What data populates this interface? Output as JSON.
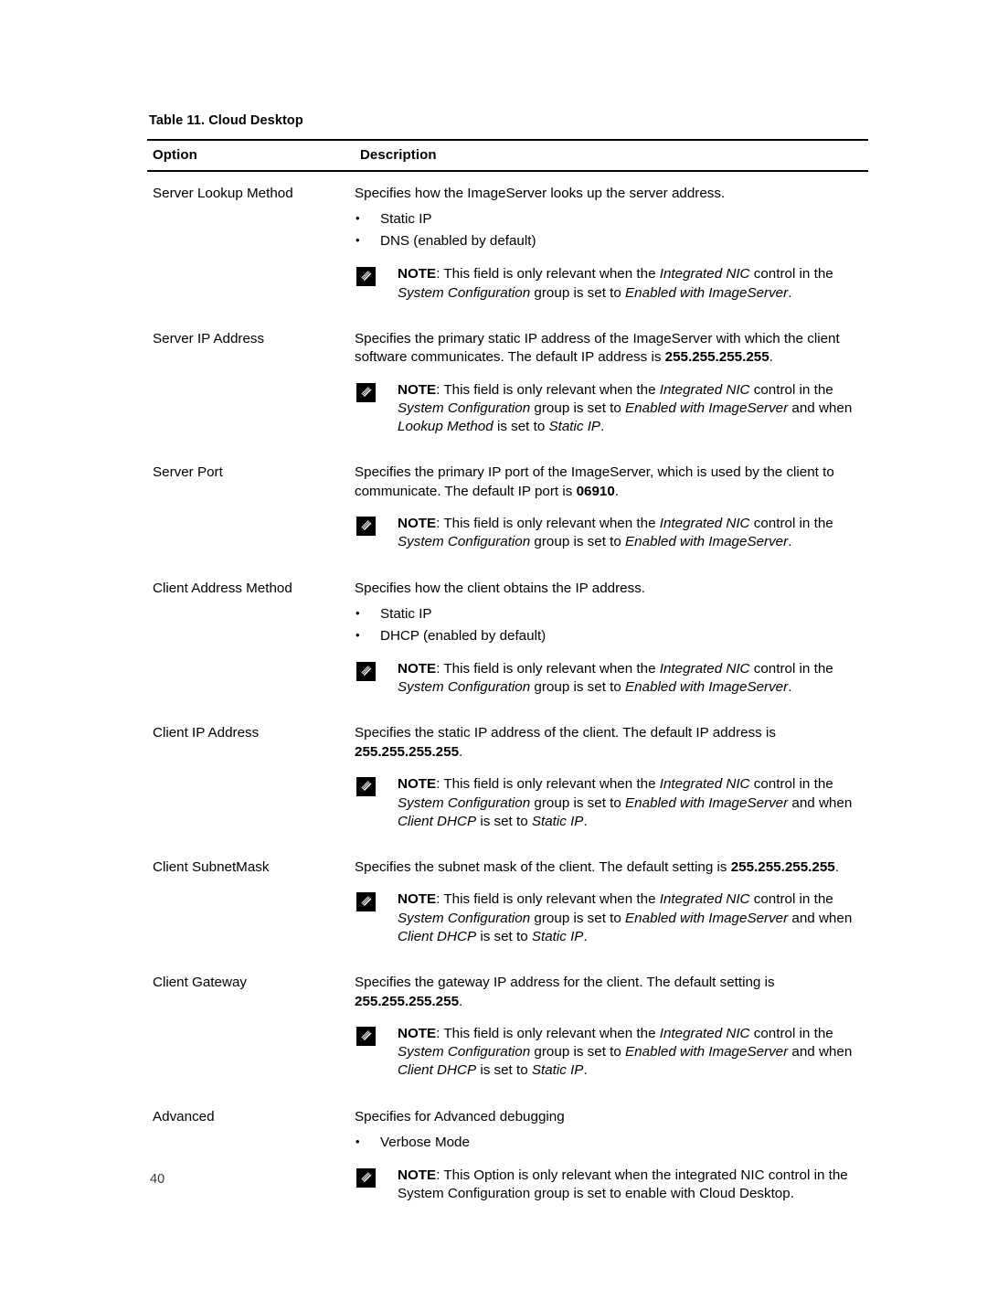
{
  "page": {
    "number": "40"
  },
  "table": {
    "caption_number": "Table 11.",
    "caption_title": "Cloud Desktop",
    "headers": {
      "option": "Option",
      "description": "Description"
    },
    "note_label": "NOTE",
    "note_icon": "note-pencil-icon",
    "rows": [
      {
        "option": "Server Lookup Method",
        "intro": "Specifies how the ImageServer looks up the server address.",
        "bullets": [
          "Static IP",
          "DNS (enabled by default)"
        ],
        "note": {
          "l1_a": ": This field is only relevant when the ",
          "l1_em": "Integrated NIC",
          "l1_b": " control in the ",
          "l2_em": "System Configuration",
          "l2_a": " group is set to ",
          "l2_em2": "Enabled with ImageServer",
          "l2_b": "."
        }
      },
      {
        "option": "Server IP Address",
        "intro_a": "Specifies the primary static IP address of the ImageServer with which the client software communicates. The default IP address is ",
        "intro_bold": "255.255.255.255",
        "intro_b": ".",
        "note": {
          "l1_a": ": This field is only relevant when the ",
          "l1_em": "Integrated NIC",
          "l1_b": " control in the ",
          "l2_em": "System Configuration",
          "l2_a": " group is set to ",
          "l2_em2": "Enabled with ImageServer",
          "l3_a": " and when ",
          "l3_em": "Lookup Method",
          "l3_b": " is set to ",
          "l3_em2": "Static IP",
          "l3_c": "."
        }
      },
      {
        "option": "Server Port",
        "intro_a": "Specifies the primary IP port of the ImageServer, which is used by the client to communicate. The default IP port is ",
        "intro_bold": "06910",
        "intro_b": ".",
        "note": {
          "l1_a": ": This field is only relevant when the ",
          "l1_em": "Integrated NIC",
          "l1_b": " control in the ",
          "l2_em": "System Configuration",
          "l2_a": " group is set to ",
          "l2_em2": "Enabled with ImageServer",
          "l2_b": "."
        }
      },
      {
        "option": "Client Address Method",
        "intro": "Specifies how the client obtains the IP address.",
        "bullets": [
          "Static IP",
          "DHCP (enabled by default)"
        ],
        "note": {
          "l1_a": ": This field is only relevant when the ",
          "l1_em": "Integrated NIC",
          "l1_b": " control in the ",
          "l2_em": "System Configuration",
          "l2_a": " group is set to ",
          "l2_em2": "Enabled with ImageServer",
          "l2_b": "."
        }
      },
      {
        "option": "Client IP Address",
        "intro_a": "Specifies the static IP address of the client. The default IP address is ",
        "intro_bold": "255.255.255.255",
        "intro_b": ".",
        "note": {
          "l1_a": ": This field is only relevant when the ",
          "l1_em": "Integrated NIC",
          "l1_b": " control in the ",
          "l2_em": "System Configuration",
          "l2_a": " group is set to ",
          "l2_em2": "Enabled with ImageServer",
          "l3_a": " and when ",
          "l3_em": "Client DHCP",
          "l3_b": " is set to ",
          "l3_em2": "Static IP",
          "l3_c": "."
        }
      },
      {
        "option": "Client SubnetMask",
        "intro_a": "Specifies the subnet mask of the client. The default setting is ",
        "intro_bold": "255.255.255.255",
        "intro_b": ".",
        "note": {
          "l1_a": ": This field is only relevant when the ",
          "l1_em": "Integrated NIC",
          "l1_b": " control in the ",
          "l2_em": "System Configuration",
          "l2_a": " group is set to ",
          "l2_em2": "Enabled with ImageServer",
          "l3_a": " and when ",
          "l3_em": "Client DHCP",
          "l3_b": " is set to ",
          "l3_em2": "Static IP",
          "l3_c": "."
        }
      },
      {
        "option": "Client Gateway",
        "intro_a": "Specifies the gateway IP address for the client. The default setting is ",
        "intro_bold": "255.255.255.255",
        "intro_b": ".",
        "note": {
          "l1_a": ": This field is only relevant when the ",
          "l1_em": "Integrated NIC",
          "l1_b": " control in the ",
          "l2_em": "System Configuration",
          "l2_a": " group is set to ",
          "l2_em2": "Enabled with ImageServer",
          "l3_a": " and when ",
          "l3_em": "Client DHCP",
          "l3_b": " is set to ",
          "l3_em2": "Static IP",
          "l3_c": "."
        }
      },
      {
        "option": "Advanced",
        "intro": "Specifies for Advanced debugging",
        "bullets": [
          "Verbose Mode"
        ],
        "note_plain": ": This Option is only relevant when the integrated NIC control in the System Configuration group is set to enable with Cloud Desktop."
      }
    ]
  }
}
